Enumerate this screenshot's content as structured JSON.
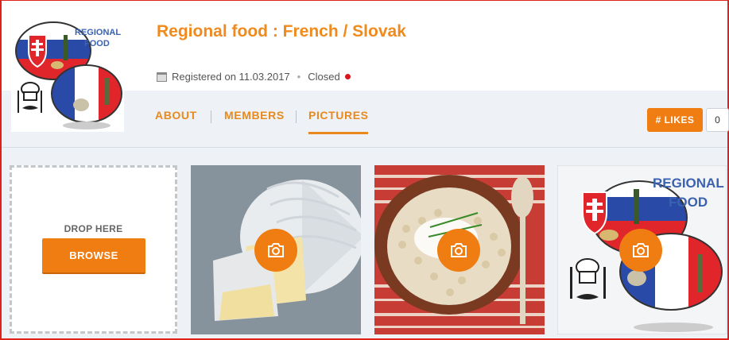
{
  "header": {
    "title": "Regional food : French / Slovak",
    "registered": "Registered on 11.03.2017",
    "status": "Closed",
    "status_color": "#d8141c"
  },
  "logo": {
    "text_line1": "REGIONAL",
    "text_line2": "FOOD"
  },
  "nav": {
    "tabs": [
      {
        "label": "ABOUT"
      },
      {
        "label": "MEMBERS"
      },
      {
        "label": "PICTURES",
        "active": true
      }
    ],
    "likes_label": "# LIKES",
    "likes_count": "0"
  },
  "upload": {
    "drop_label": "DROP HERE",
    "browse_label": "BROWSE"
  },
  "pictures": [
    {
      "subject": "camembert cheese",
      "icon": "camera-icon"
    },
    {
      "subject": "halusky dumplings dish",
      "icon": "camera-icon"
    },
    {
      "subject": "regional food logo",
      "icon": "camera-icon"
    }
  ],
  "colors": {
    "accent": "#ef7d12",
    "title": "#f08a1c"
  }
}
